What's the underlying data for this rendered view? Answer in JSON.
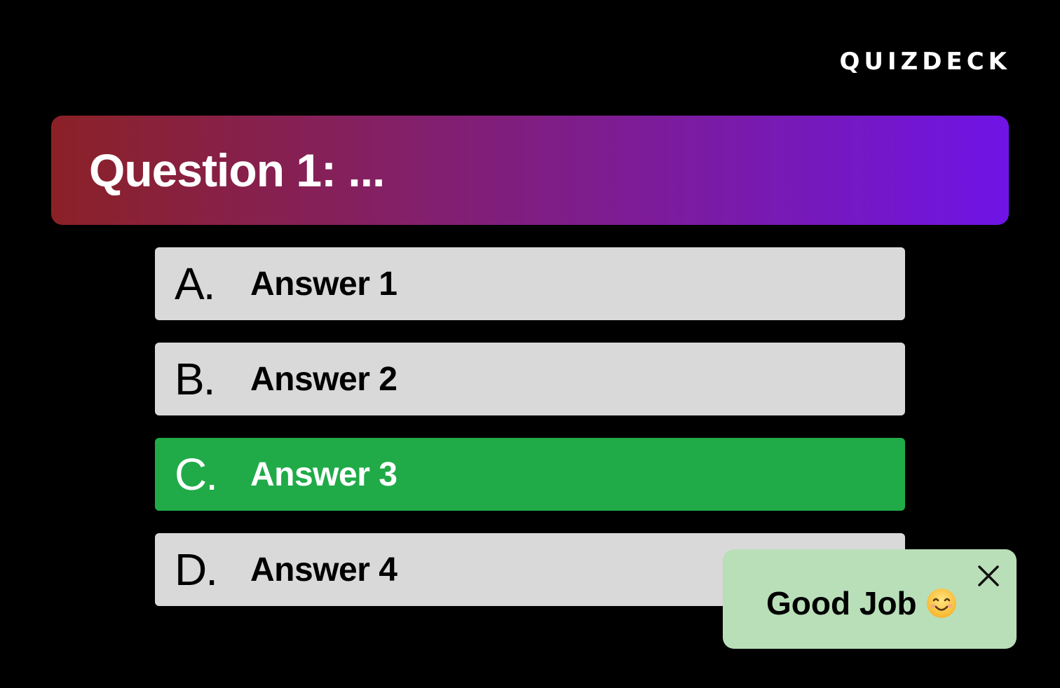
{
  "header": {
    "logo_text": "QUIZDECK"
  },
  "question": {
    "title": "Question 1: ...",
    "gradient": [
      "#8b2126",
      "#6f14e6"
    ]
  },
  "answers": [
    {
      "letter": "A.",
      "label": "Answer 1",
      "state": "default"
    },
    {
      "letter": "B.",
      "label": "Answer 2",
      "state": "default"
    },
    {
      "letter": "C.",
      "label": "Answer 3",
      "state": "correct"
    },
    {
      "letter": "D.",
      "label": "Answer 4",
      "state": "default"
    }
  ],
  "colors": {
    "answer_default": "#d9d9d9",
    "answer_correct": "#20ab48",
    "toast_bg": "#b9dfb9"
  },
  "toast": {
    "message": "Good Job",
    "emoji_icon": "smiling-face-icon",
    "close_icon": "close-icon"
  }
}
